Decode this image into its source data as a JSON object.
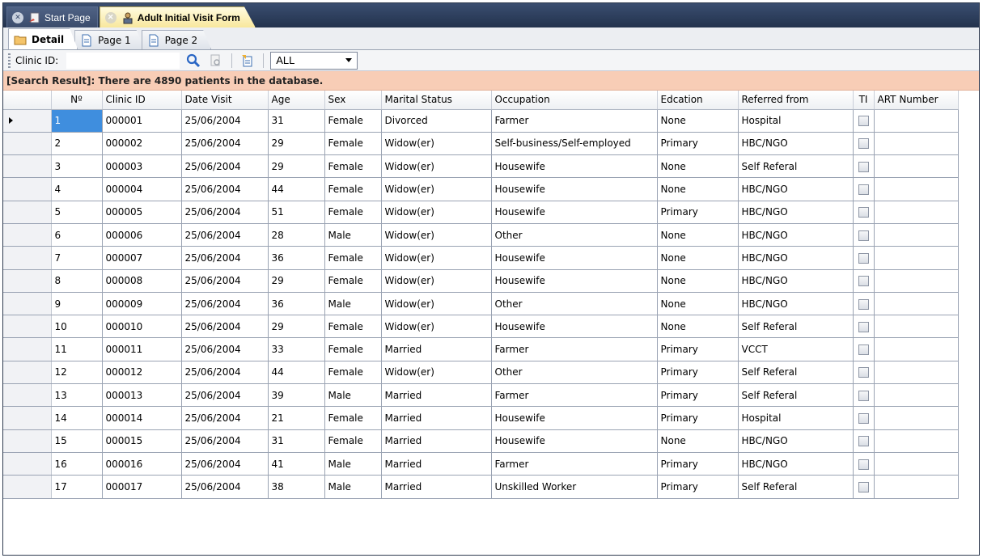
{
  "doc_tabs": [
    {
      "label": "Start Page",
      "active": false
    },
    {
      "label": "Adult Initial Visit Form",
      "active": true
    }
  ],
  "sub_tabs": [
    {
      "label": "Detail",
      "active": true
    },
    {
      "label": "Page 1",
      "active": false
    },
    {
      "label": "Page 2",
      "active": false
    }
  ],
  "toolbar": {
    "clinic_label": "Clinic ID:",
    "clinic_value": "",
    "filter_selected": "ALL"
  },
  "result_text": "[Search Result]: There are 4890 patients in the database.",
  "columns": [
    "Nº",
    "Clinic ID",
    "Date Visit",
    "Age",
    "Sex",
    "Marital Status",
    "Occupation",
    "Edcation",
    "Referred from",
    "TI",
    "ART Number"
  ],
  "rows": [
    {
      "no": "1",
      "clinic_id": "000001",
      "date": "25/06/2004",
      "age": "31",
      "sex": "Female",
      "marital": "Divorced",
      "occupation": "Farmer",
      "education": "None",
      "referred": "Hospital",
      "ti": false,
      "art": ""
    },
    {
      "no": "2",
      "clinic_id": "000002",
      "date": "25/06/2004",
      "age": "29",
      "sex": "Female",
      "marital": "Widow(er)",
      "occupation": "Self-business/Self-employed",
      "education": "Primary",
      "referred": "HBC/NGO",
      "ti": false,
      "art": ""
    },
    {
      "no": "3",
      "clinic_id": "000003",
      "date": "25/06/2004",
      "age": "29",
      "sex": "Female",
      "marital": "Widow(er)",
      "occupation": "Housewife",
      "education": "None",
      "referred": "Self Referal",
      "ti": false,
      "art": ""
    },
    {
      "no": "4",
      "clinic_id": "000004",
      "date": "25/06/2004",
      "age": "44",
      "sex": "Female",
      "marital": "Widow(er)",
      "occupation": "Housewife",
      "education": "None",
      "referred": "HBC/NGO",
      "ti": false,
      "art": ""
    },
    {
      "no": "5",
      "clinic_id": "000005",
      "date": "25/06/2004",
      "age": "51",
      "sex": "Female",
      "marital": "Widow(er)",
      "occupation": "Housewife",
      "education": "Primary",
      "referred": "HBC/NGO",
      "ti": false,
      "art": ""
    },
    {
      "no": "6",
      "clinic_id": "000006",
      "date": "25/06/2004",
      "age": "28",
      "sex": "Male",
      "marital": "Widow(er)",
      "occupation": "Other",
      "education": "None",
      "referred": "HBC/NGO",
      "ti": false,
      "art": ""
    },
    {
      "no": "7",
      "clinic_id": "000007",
      "date": "25/06/2004",
      "age": "36",
      "sex": "Female",
      "marital": "Widow(er)",
      "occupation": "Housewife",
      "education": "None",
      "referred": "HBC/NGO",
      "ti": false,
      "art": ""
    },
    {
      "no": "8",
      "clinic_id": "000008",
      "date": "25/06/2004",
      "age": "29",
      "sex": "Female",
      "marital": "Widow(er)",
      "occupation": "Housewife",
      "education": "None",
      "referred": "HBC/NGO",
      "ti": false,
      "art": ""
    },
    {
      "no": "9",
      "clinic_id": "000009",
      "date": "25/06/2004",
      "age": "36",
      "sex": "Male",
      "marital": "Widow(er)",
      "occupation": "Other",
      "education": "None",
      "referred": "HBC/NGO",
      "ti": false,
      "art": ""
    },
    {
      "no": "10",
      "clinic_id": "000010",
      "date": "25/06/2004",
      "age": "29",
      "sex": "Female",
      "marital": "Widow(er)",
      "occupation": "Housewife",
      "education": "None",
      "referred": "Self Referal",
      "ti": false,
      "art": ""
    },
    {
      "no": "11",
      "clinic_id": "000011",
      "date": "25/06/2004",
      "age": "33",
      "sex": "Female",
      "marital": "Married",
      "occupation": "Farmer",
      "education": "Primary",
      "referred": "VCCT",
      "ti": false,
      "art": ""
    },
    {
      "no": "12",
      "clinic_id": "000012",
      "date": "25/06/2004",
      "age": "44",
      "sex": "Female",
      "marital": "Widow(er)",
      "occupation": "Other",
      "education": "Primary",
      "referred": "Self Referal",
      "ti": false,
      "art": ""
    },
    {
      "no": "13",
      "clinic_id": "000013",
      "date": "25/06/2004",
      "age": "39",
      "sex": "Male",
      "marital": "Married",
      "occupation": "Farmer",
      "education": "Primary",
      "referred": "Self Referal",
      "ti": false,
      "art": ""
    },
    {
      "no": "14",
      "clinic_id": "000014",
      "date": "25/06/2004",
      "age": "21",
      "sex": "Female",
      "marital": "Married",
      "occupation": "Housewife",
      "education": "Primary",
      "referred": "Hospital",
      "ti": false,
      "art": ""
    },
    {
      "no": "15",
      "clinic_id": "000015",
      "date": "25/06/2004",
      "age": "31",
      "sex": "Female",
      "marital": "Married",
      "occupation": "Housewife",
      "education": "None",
      "referred": "HBC/NGO",
      "ti": false,
      "art": ""
    },
    {
      "no": "16",
      "clinic_id": "000016",
      "date": "25/06/2004",
      "age": "41",
      "sex": "Male",
      "marital": "Married",
      "occupation": "Farmer",
      "education": "Primary",
      "referred": "HBC/NGO",
      "ti": false,
      "art": ""
    },
    {
      "no": "17",
      "clinic_id": "000017",
      "date": "25/06/2004",
      "age": "38",
      "sex": "Male",
      "marital": "Married",
      "occupation": "Unskilled Worker",
      "education": "Primary",
      "referred": "Self Referal",
      "ti": false,
      "art": ""
    }
  ],
  "selected_row": 0,
  "colors": {
    "result_bar": "#f8cdb6",
    "selected_cell": "#3f8ede",
    "doc_strip": "#2b3b58",
    "active_doc_tab": "#f8e79c"
  }
}
